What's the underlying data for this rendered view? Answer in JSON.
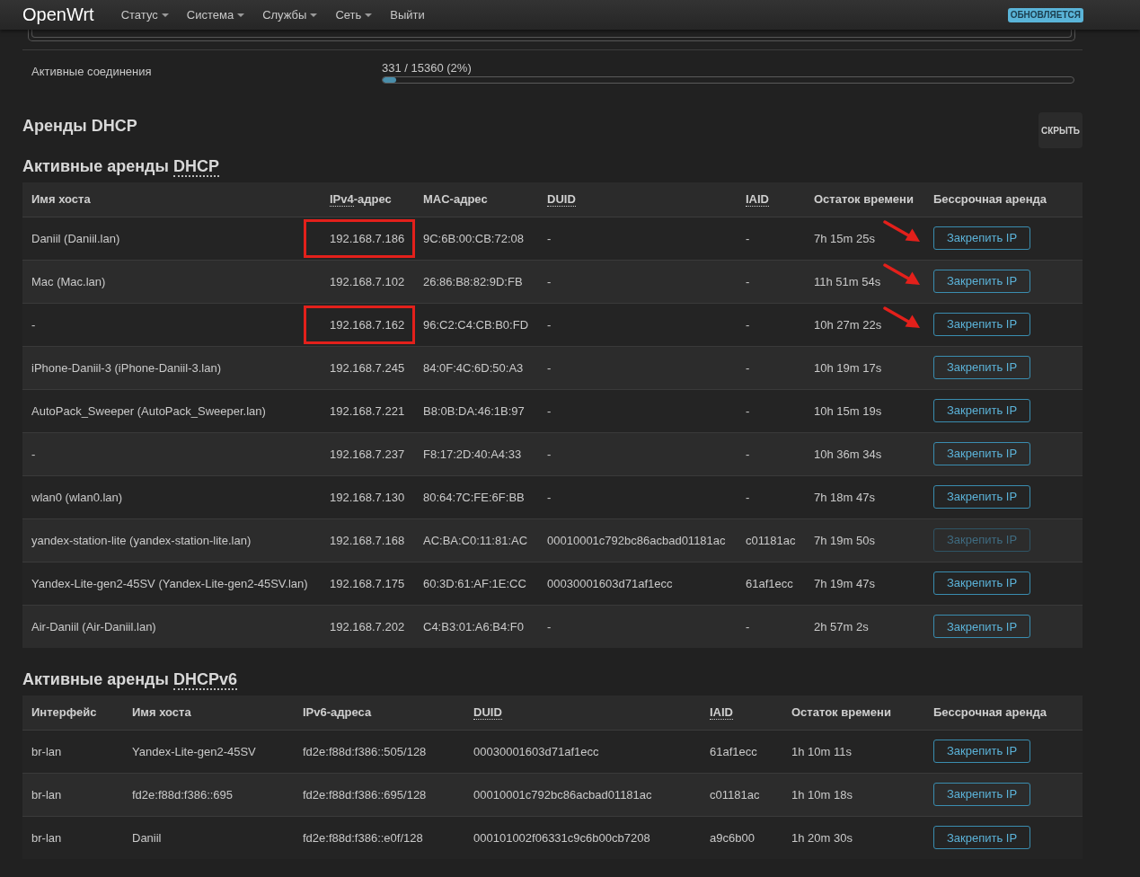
{
  "header": {
    "logo": "OpenWrt",
    "menu": [
      {
        "label": "Статус",
        "dropdown": true
      },
      {
        "label": "Система",
        "dropdown": true
      },
      {
        "label": "Службы",
        "dropdown": true
      },
      {
        "label": "Сеть",
        "dropdown": true
      },
      {
        "label": "Выйти",
        "dropdown": false
      }
    ],
    "badge": "ОБНОВЛЯЕТСЯ"
  },
  "connections": {
    "label": "Активные соединения",
    "value": "331 / 15360 (2%)",
    "level": 0.02
  },
  "dhcp_section": {
    "title": "Аренды DHCP",
    "hide_button": "СКРЫТЬ"
  },
  "dhcp_leases": {
    "heading": {
      "text": "Активные аренды",
      "abbr": "DHCP"
    },
    "columns": [
      {
        "label": "Имя хоста"
      },
      {
        "abbr": "IPv4",
        "label": "-адрес"
      },
      {
        "label": "MAC-адрес"
      },
      {
        "abbr": "DUID"
      },
      {
        "abbr": "IAID"
      },
      {
        "label": "Остаток времени"
      },
      {
        "label": "Бессрочная аренда"
      }
    ],
    "rows": [
      {
        "cells": [
          "Daniil (Daniil.lan)",
          "192.168.7.186",
          "9C:6B:00:CB:72:08",
          "-",
          "-",
          "7h 15m 25s"
        ],
        "button": {
          "label": "Закрепить IP",
          "disabled": false
        },
        "ip_highlighted": true,
        "arrow": true
      },
      {
        "cells": [
          "Mac (Mac.lan)",
          "192.168.7.102",
          "26:86:B8:82:9D:FB",
          "-",
          "-",
          "11h 51m 54s"
        ],
        "button": {
          "label": "Закрепить IP",
          "disabled": false
        },
        "ip_highlighted": false,
        "arrow": true
      },
      {
        "cells": [
          "-",
          "192.168.7.162",
          "96:C2:C4:CB:B0:FD",
          "-",
          "-",
          "10h 27m 22s"
        ],
        "button": {
          "label": "Закрепить IP",
          "disabled": false
        },
        "ip_highlighted": true,
        "arrow": true
      },
      {
        "cells": [
          "iPhone-Daniil-3 (iPhone-Daniil-3.lan)",
          "192.168.7.245",
          "84:0F:4C:6D:50:A3",
          "-",
          "-",
          "10h 19m 17s"
        ],
        "button": {
          "label": "Закрепить IP",
          "disabled": false
        },
        "ip_highlighted": false,
        "arrow": false
      },
      {
        "cells": [
          "AutoPack_Sweeper (AutoPack_Sweeper.lan)",
          "192.168.7.221",
          "B8:0B:DA:46:1B:97",
          "-",
          "-",
          "10h 15m 19s"
        ],
        "button": {
          "label": "Закрепить IP",
          "disabled": false
        },
        "ip_highlighted": false,
        "arrow": false
      },
      {
        "cells": [
          "-",
          "192.168.7.237",
          "F8:17:2D:40:A4:33",
          "-",
          "-",
          "10h 36m 34s"
        ],
        "button": {
          "label": "Закрепить IP",
          "disabled": false
        },
        "ip_highlighted": false,
        "arrow": false
      },
      {
        "cells": [
          "wlan0 (wlan0.lan)",
          "192.168.7.130",
          "80:64:7C:FE:6F:BB",
          "-",
          "-",
          "7h 18m 47s"
        ],
        "button": {
          "label": "Закрепить IP",
          "disabled": false
        },
        "ip_highlighted": false,
        "arrow": false
      },
      {
        "cells": [
          "yandex-station-lite (yandex-station-lite.lan)",
          "192.168.7.168",
          "AC:BA:C0:11:81:AC",
          "00010001c792bc86acbad01181ac",
          "c01181ac",
          "7h 19m 50s"
        ],
        "button": {
          "label": "Закрепить IP",
          "disabled": true
        },
        "ip_highlighted": false,
        "arrow": false
      },
      {
        "cells": [
          "Yandex-Lite-gen2-45SV (Yandex-Lite-gen2-45SV.lan)",
          "192.168.7.175",
          "60:3D:61:AF:1E:CC",
          "00030001603d71af1ecc",
          "61af1ecc",
          "7h 19m 47s"
        ],
        "button": {
          "label": "Закрепить IP",
          "disabled": false
        },
        "ip_highlighted": false,
        "arrow": false
      },
      {
        "cells": [
          "Air-Daniil (Air-Daniil.lan)",
          "192.168.7.202",
          "C4:B3:01:A6:B4:F0",
          "-",
          "-",
          "2h 57m 2s"
        ],
        "button": {
          "label": "Закрепить IP",
          "disabled": false
        },
        "ip_highlighted": false,
        "arrow": false
      }
    ]
  },
  "dhcpv6_leases": {
    "heading": {
      "text": "Активные аренды",
      "abbr": "DHCPv6"
    },
    "columns": [
      {
        "label": "Интерфейс"
      },
      {
        "label": "Имя хоста"
      },
      {
        "label": "IPv6-адреса"
      },
      {
        "abbr": "DUID"
      },
      {
        "abbr": "IAID"
      },
      {
        "label": "Остаток времени"
      },
      {
        "label": "Бессрочная аренда"
      }
    ],
    "rows": [
      {
        "cells": [
          "br-lan",
          "Yandex-Lite-gen2-45SV",
          "fd2e:f88d:f386::505/128",
          "00030001603d71af1ecc",
          "61af1ecc",
          "1h 10m 11s"
        ],
        "button": {
          "label": "Закрепить IP",
          "disabled": false
        }
      },
      {
        "cells": [
          "br-lan",
          "fd2e:f88d:f386::695",
          "fd2e:f88d:f386::695/128",
          "00010001c792bc86acbad01181ac",
          "c01181ac",
          "1h 10m 18s"
        ],
        "button": {
          "label": "Закрепить IP",
          "disabled": false
        }
      },
      {
        "cells": [
          "br-lan",
          "Daniil",
          "fd2e:f88d:f386::e0f/128",
          "000101002f06331c9c6b00cb7208",
          "a9c6b00",
          "1h 20m 30s"
        ],
        "button": {
          "label": "Закрепить IP",
          "disabled": false
        }
      }
    ]
  }
}
